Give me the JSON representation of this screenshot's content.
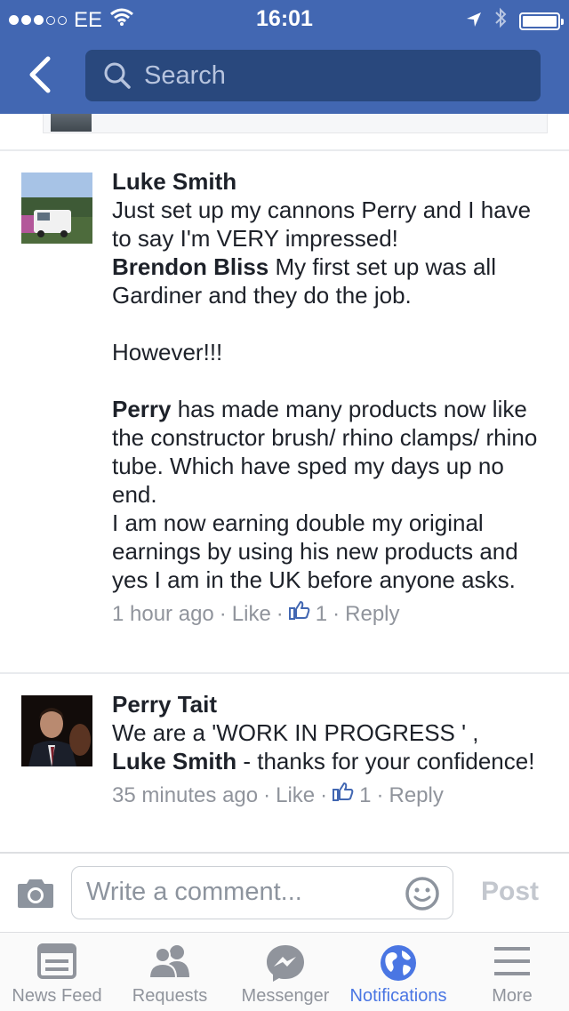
{
  "status_bar": {
    "carrier": "EE",
    "time": "16:01"
  },
  "header": {
    "search_placeholder": "Search"
  },
  "comments": [
    {
      "author": "Luke Smith",
      "body": [
        {
          "type": "text",
          "text": "Just set up my cannons Perry and I have to say I'm VERY impressed!"
        },
        {
          "type": "mention",
          "text": "Brendon Bliss"
        },
        {
          "type": "text",
          "text": " My first set up was all Gardiner and they do the job."
        },
        {
          "type": "break"
        },
        {
          "type": "text",
          "text": "However!!!"
        },
        {
          "type": "break"
        },
        {
          "type": "mention",
          "text": "Perry"
        },
        {
          "type": "text",
          "text": " has made many products now like the constructor brush/ rhino clamps/ rhino tube. Which have sped my days up no end."
        },
        {
          "type": "text",
          "text": "I am now earning double my original earnings by using his new products and yes I am in the UK before anyone asks."
        }
      ],
      "time": "1 hour ago",
      "like_label": "Like",
      "like_count": "1",
      "reply_label": "Reply"
    },
    {
      "author": "Perry Tait",
      "line1": "We are a 'WORK IN PROGRESS ' ,",
      "mention": "Luke Smith",
      "line2": " - thanks for your confidence!",
      "time": "35 minutes ago",
      "like_label": "Like",
      "like_count": "1",
      "reply_label": "Reply"
    }
  ],
  "composer": {
    "placeholder": "Write a comment...",
    "post_label": "Post"
  },
  "tabs": [
    {
      "label": "News Feed",
      "icon": "news-feed-icon",
      "active": false
    },
    {
      "label": "Requests",
      "icon": "friend-requests-icon",
      "active": false
    },
    {
      "label": "Messenger",
      "icon": "messenger-icon",
      "active": false
    },
    {
      "label": "Notifications",
      "icon": "globe-icon",
      "active": true
    },
    {
      "label": "More",
      "icon": "menu-icon",
      "active": false
    }
  ],
  "colors": {
    "brand": "#4267b2",
    "search_bg": "#29487d",
    "active_tab": "#4a76e3",
    "meta_text": "#90949c"
  }
}
